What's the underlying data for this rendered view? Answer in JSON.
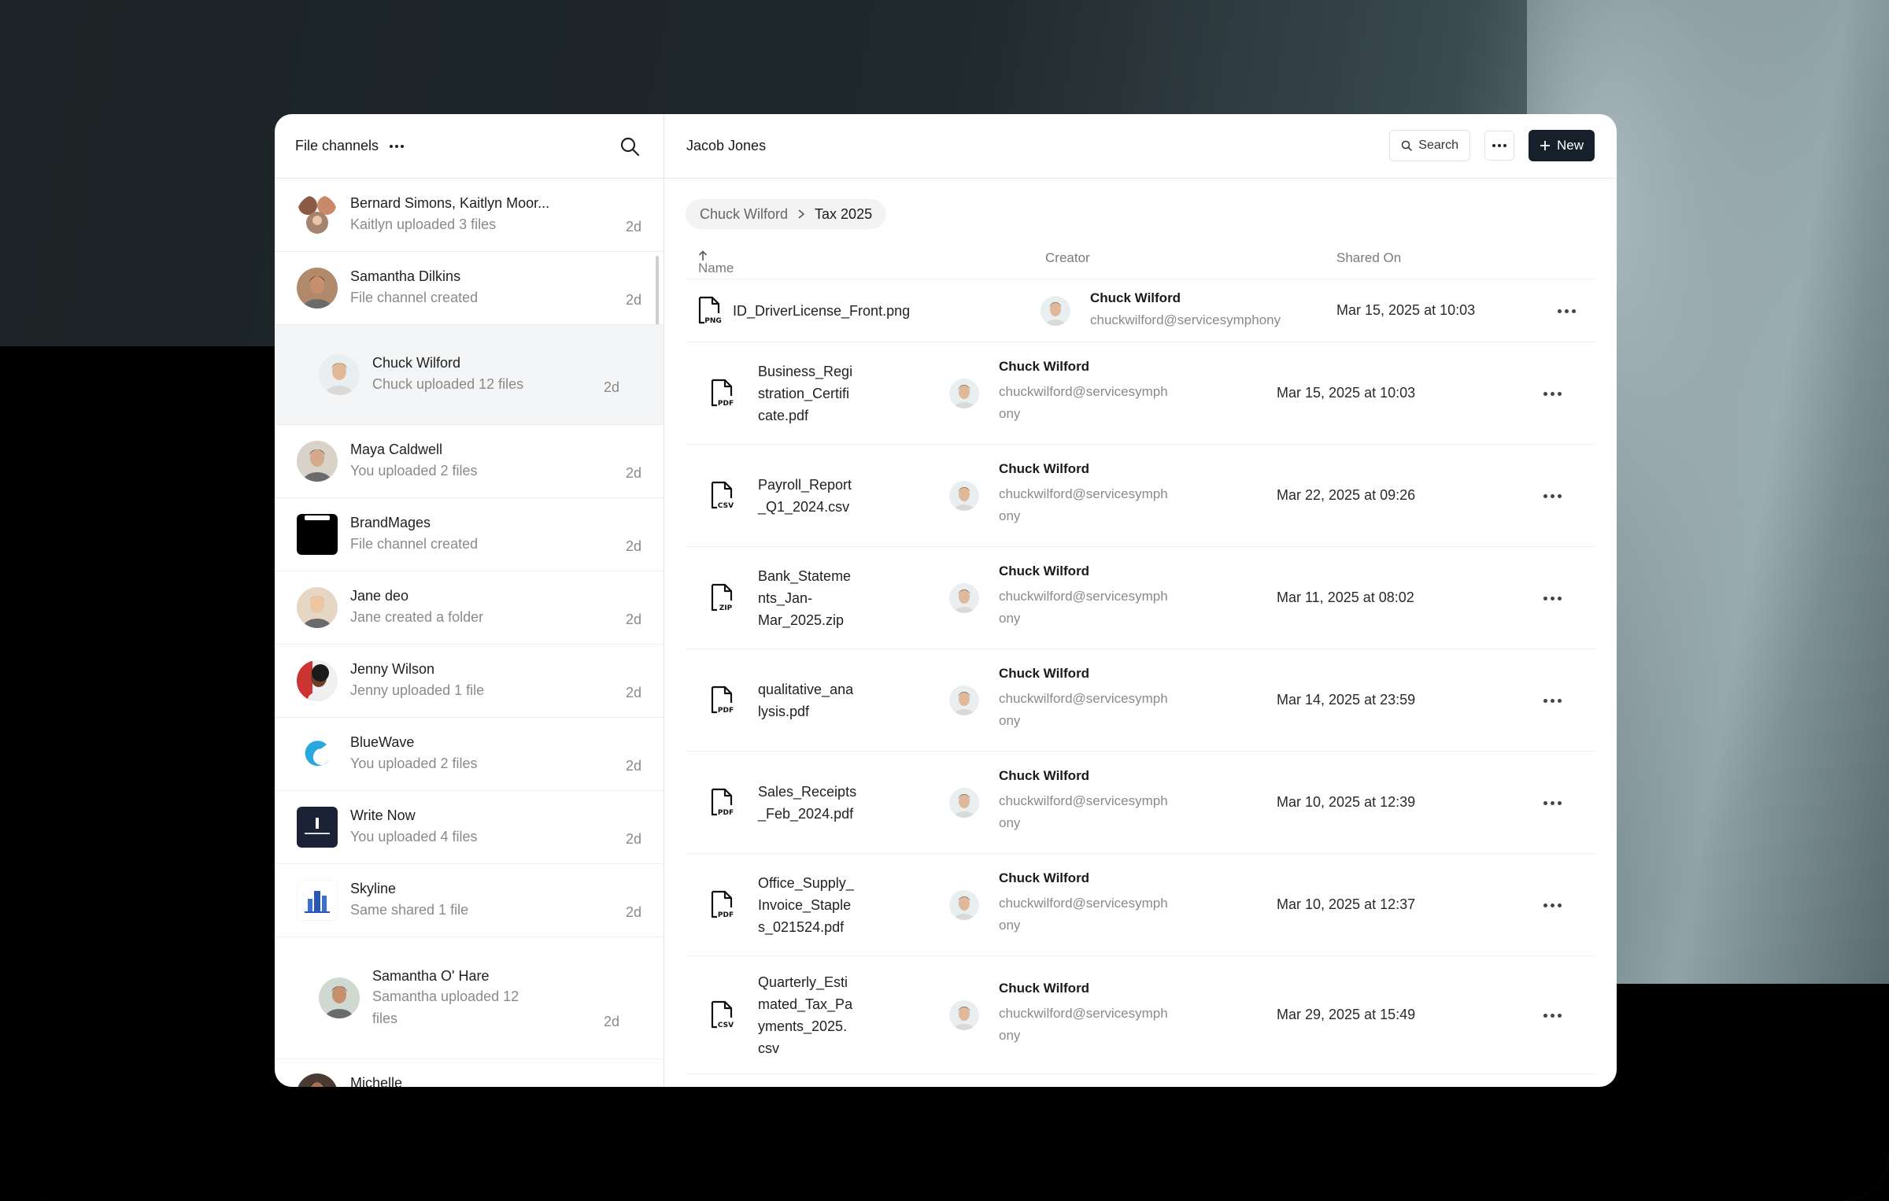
{
  "sidebar": {
    "title": "File channels",
    "channels": [
      {
        "name": "Bernard Simons, Kaitlyn Moor...",
        "sub": "Kaitlyn uploaded 3 files",
        "time": "2d"
      },
      {
        "name": "Samantha Dilkins",
        "sub": "File channel created",
        "time": "2d"
      },
      {
        "name": "Chuck Wilford",
        "sub": "Chuck uploaded 12 files",
        "time": "2d"
      },
      {
        "name": "Maya Caldwell",
        "sub": "You uploaded 2 files",
        "time": "2d"
      },
      {
        "name": "BrandMages",
        "sub": "File channel created",
        "time": "2d"
      },
      {
        "name": "Jane deo",
        "sub": "Jane created a folder",
        "time": "2d"
      },
      {
        "name": "Jenny Wilson",
        "sub": "Jenny uploaded 1 file",
        "time": "2d"
      },
      {
        "name": "BlueWave",
        "sub": "You uploaded 2 files",
        "time": "2d"
      },
      {
        "name": "Write Now",
        "sub": "You uploaded 4 files",
        "time": "2d"
      },
      {
        "name": "Skyline",
        "sub": "Same shared 1 file",
        "time": "2d"
      },
      {
        "name": "Samantha O' Hare",
        "sub": "Samantha uploaded 12 files",
        "time": "2d"
      },
      {
        "name": "Michelle",
        "sub": "",
        "time": ""
      }
    ]
  },
  "main": {
    "title": "Jacob Jones",
    "search_label": "Search",
    "new_label": "New",
    "breadcrumb": {
      "parent": "Chuck Wilford",
      "current": "Tax 2025"
    },
    "columns": {
      "name": "Name",
      "creator": "Creator",
      "shared": "Shared On"
    },
    "files": [
      {
        "type": "PNG",
        "name": "ID_DriverLicense_Front.png",
        "creator": "Chuck Wilford",
        "email": "chuckwilford@servicesymphony",
        "shared": "Mar 15, 2025 at 10:03"
      },
      {
        "type": "PDF",
        "name": "Business_Registration_Certificate.pdf",
        "creator": "Chuck Wilford",
        "email": "chuckwilford@servicesymphony",
        "shared": "Mar 15, 2025 at 10:03"
      },
      {
        "type": "CSV",
        "name": "Payroll_Report_Q1_2024.csv",
        "creator": "Chuck Wilford",
        "email": "chuckwilford@servicesymphony",
        "shared": "Mar 22, 2025 at 09:26"
      },
      {
        "type": "ZIP",
        "name": "Bank_Statements_Jan-Mar_2025.zip",
        "creator": "Chuck Wilford",
        "email": "chuckwilford@servicesymphony",
        "shared": "Mar 11, 2025 at 08:02"
      },
      {
        "type": "PDF",
        "name": "qualitative_analysis.pdf",
        "creator": "Chuck Wilford",
        "email": "chuckwilford@servicesymphony",
        "shared": "Mar 14, 2025 at 23:59"
      },
      {
        "type": "PDF",
        "name": "Sales_Receipts_Feb_2024.pdf",
        "creator": "Chuck Wilford",
        "email": "chuckwilford@servicesymphony",
        "shared": "Mar 10, 2025 at 12:39"
      },
      {
        "type": "PDF",
        "name": "Office_Supply_Invoice_Staples_021524.pdf",
        "creator": "Chuck Wilford",
        "email": "chuckwilford@servicesymphony",
        "shared": "Mar 10, 2025 at 12:37"
      },
      {
        "type": "CSV",
        "name": "Quarterly_Estimated_Tax_Payments_2025.csv",
        "creator": "Chuck Wilford",
        "email": "chuckwilford@servicesymphony",
        "shared": "Mar 29, 2025 at 15:49"
      }
    ]
  },
  "name_lines": [
    [
      "ID_DriverLicense_Front.png"
    ],
    [
      "Business_Regi",
      "stration_Certifi",
      "cate.pdf"
    ],
    [
      "Payroll_Report",
      "_Q1_2024.csv"
    ],
    [
      "Bank_Stateme",
      "nts_Jan-",
      "Mar_2025.zip"
    ],
    [
      "qualitative_ana",
      "lysis.pdf"
    ],
    [
      "Sales_Receipts",
      "_Feb_2024.pdf"
    ],
    [
      "Office_Supply_",
      "Invoice_Staple",
      "s_021524.pdf"
    ],
    [
      "Quarterly_Esti",
      "mated_Tax_Pa",
      "yments_2025.",
      "csv"
    ]
  ],
  "email_lines": [
    "chuckwilford@servicesymph",
    "ony"
  ],
  "colors": {
    "new_button": "#15202a",
    "active_channel": "#f4f5f6"
  }
}
